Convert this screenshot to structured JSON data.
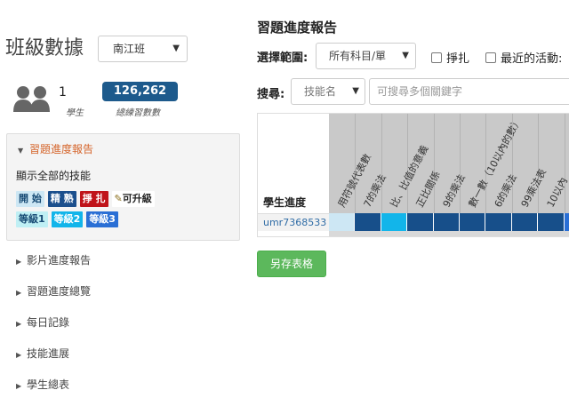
{
  "sidebar": {
    "class_title": "班級數據",
    "class_select": "南江班",
    "stats": {
      "students_count": "1",
      "students_label": "學生",
      "total_problems": "126,262",
      "total_problems_label": "總練習數數"
    },
    "panel": {
      "title": "習題進度報告",
      "subtitle": "顯示全部的技能",
      "legend": [
        {
          "label": "開 始",
          "kind": "start"
        },
        {
          "label": "精 熟",
          "kind": "proficient"
        },
        {
          "label": "掙 扎",
          "kind": "struggle"
        },
        {
          "label": "可升級",
          "kind": "upgradable"
        }
      ],
      "levels": [
        {
          "label": "等級1",
          "kind": "lv1"
        },
        {
          "label": "等級2",
          "kind": "lv2"
        },
        {
          "label": "等級3",
          "kind": "lv3"
        }
      ]
    },
    "nav": [
      "影片進度報告",
      "習題進度總覽",
      "每日記錄",
      "技能進展",
      "學生總表"
    ]
  },
  "report": {
    "title": "習題進度報告",
    "range_label": "選擇範圍:",
    "range_value": "所有科目/單",
    "checkbox_struggle": "掙扎",
    "checkbox_recent": "最近的活動:",
    "search_label": "搜尋:",
    "skill_select": "技能名",
    "search_placeholder": "可搜尋多個關鍵字",
    "grid_header": "學生進度",
    "columns": [
      "用符號代表數",
      "7的乘法",
      "比、比值的意義",
      "正比關係",
      "9的乘法",
      "數一數（10以內的數）",
      "6的乘法",
      "99乘法表",
      "10以內"
    ],
    "student": "umr7368533",
    "save_button": "另存表格"
  },
  "colors": {
    "accent_orange": "#d5652b",
    "badge_blue": "#1d5a8c",
    "cell_start": "#cde7f4",
    "cell_proficient": "#174f8a",
    "cell_lv2": "#12b5ea",
    "save_green": "#5cb85c"
  },
  "row_cells": [
    "start",
    "proficient",
    "lv2",
    "proficient",
    "proficient",
    "proficient",
    "proficient",
    "proficient",
    "proficient",
    "lv3"
  ],
  "icons": {
    "users": "users-icon",
    "caret": "caret-down-icon",
    "nav_arrow": "caret-right-icon",
    "panel_arrow": "caret-down-icon"
  }
}
